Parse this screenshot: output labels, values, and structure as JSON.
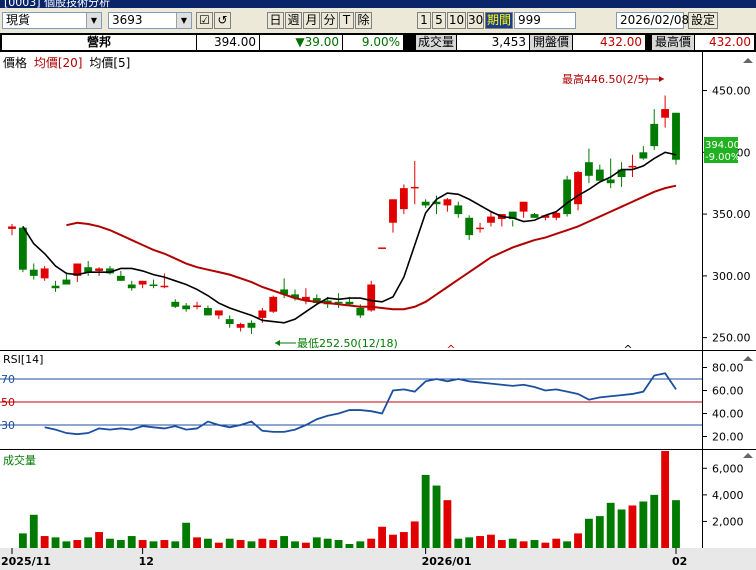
{
  "window": {
    "title": "[0003] 個股技術分析"
  },
  "toolbar": {
    "market": "現貨",
    "code": "3693",
    "period_buttons": [
      "日",
      "週",
      "月",
      "分",
      "T"
    ],
    "remove_label": "除",
    "minute_buttons": [
      "1",
      "5",
      "10",
      "30"
    ],
    "range_label": "期間",
    "range_value": "999",
    "date_value": "2026/02/08",
    "settings_label": "設定"
  },
  "quote": {
    "name": "營邦",
    "price": "394.00",
    "change": "▼39.00",
    "change_pct": "9.00%",
    "volume_label": "成交量",
    "volume": "3,453",
    "open_label": "開盤價",
    "open": "432.00",
    "high_label": "最高價",
    "high": "432.00"
  },
  "price_panel": {
    "legend_price": "價格",
    "legend_ma20": "均價[20]",
    "legend_ma5": "均價[5]",
    "y_ticks": [
      "450.00",
      "400.00",
      "350.00",
      "300.00",
      "250.00"
    ],
    "last_price_tag": "394.00",
    "last_pct_tag": "-9.00%",
    "high_note": "最高446.50(2/5)",
    "low_note": "最低252.50(12/18)"
  },
  "rsi_panel": {
    "label": "RSI[14]",
    "level_labels": [
      "70",
      "50",
      "30"
    ],
    "y_ticks": [
      "80.00",
      "60.00",
      "40.00",
      "20.00"
    ]
  },
  "volume_panel": {
    "label": "成交量",
    "y_ticks": [
      "6,000",
      "4,000",
      "2,000"
    ]
  },
  "x_axis": {
    "labels": [
      "2025/11",
      "12",
      "2026/01",
      "02"
    ]
  },
  "colors": {
    "up": "#e00000",
    "down": "#007a00",
    "ma20": "#b00000",
    "ma5": "#000000",
    "rsi": "#1c4fa0",
    "bg": "#ffffff"
  },
  "chart_data": {
    "type": "candlestick",
    "title": "營邦",
    "ylim": [
      240,
      465
    ],
    "rsi_ylim": [
      10,
      90
    ],
    "volume_ylim": [
      0,
      7000
    ],
    "dates": [
      "2025/11 d1",
      "d2",
      "d3",
      "d4",
      "d5",
      "d6",
      "d7",
      "d8",
      "d9",
      "d10",
      "d11",
      "d12",
      "12 d1",
      "d2",
      "d3",
      "d4",
      "d5",
      "d6",
      "d7",
      "d8",
      "d9",
      "d10",
      "d11",
      "d12",
      "d13",
      "d14",
      "d15",
      "d16",
      "d17",
      "d18",
      "d19",
      "d20",
      "d21",
      "d22",
      "d23",
      "d24",
      "d25",
      "d26",
      "2026/01 d1",
      "d2",
      "d3",
      "d4",
      "d5",
      "d6",
      "d7",
      "d8",
      "d9",
      "d10",
      "d11",
      "d12",
      "d13",
      "d14",
      "d15",
      "d16",
      "d17",
      "d18",
      "d19",
      "d20",
      "d21",
      "d22",
      "d23",
      "02 d1",
      "d2",
      "d3",
      "d4",
      "d5",
      "d6"
    ],
    "ohlc": [
      [
        338,
        342,
        333,
        340
      ],
      [
        339,
        340,
        303,
        305
      ],
      [
        305,
        310,
        297,
        300
      ],
      [
        298,
        308,
        296,
        306
      ],
      [
        292,
        296,
        287,
        290
      ],
      [
        297,
        303,
        293,
        293
      ],
      [
        300,
        310,
        295,
        310
      ],
      [
        307,
        312,
        300,
        303
      ],
      [
        304,
        307,
        300,
        306
      ],
      [
        306,
        308,
        301,
        302
      ],
      [
        300,
        304,
        296,
        296
      ],
      [
        293,
        296,
        288,
        290
      ],
      [
        293,
        296,
        290,
        296
      ],
      [
        293,
        297,
        290,
        292
      ],
      [
        292,
        302,
        290,
        292
      ],
      [
        279,
        281,
        274,
        275
      ],
      [
        276,
        278,
        271,
        273
      ],
      [
        276,
        279,
        273,
        276
      ],
      [
        274,
        276,
        268,
        268
      ],
      [
        268,
        272,
        265,
        272
      ],
      [
        265,
        268,
        258,
        261
      ],
      [
        258,
        262,
        255,
        261
      ],
      [
        262,
        264,
        253,
        258
      ],
      [
        266,
        274,
        262,
        272
      ],
      [
        271,
        284,
        270,
        283
      ],
      [
        289,
        298,
        282,
        285
      ],
      [
        285,
        289,
        280,
        282
      ],
      [
        280,
        290,
        277,
        283
      ],
      [
        282,
        285,
        277,
        278
      ],
      [
        280,
        283,
        274,
        277
      ],
      [
        279,
        286,
        274,
        278
      ],
      [
        279,
        283,
        276,
        277
      ],
      [
        274,
        277,
        266,
        268
      ],
      [
        272,
        296,
        271,
        293
      ],
      [
        323,
        323,
        323,
        323
      ],
      [
        343,
        353,
        335,
        362
      ],
      [
        354,
        374,
        350,
        371
      ],
      [
        372,
        393,
        358,
        372
      ],
      [
        360,
        362,
        355,
        357
      ],
      [
        360,
        365,
        350,
        358
      ],
      [
        357,
        363,
        352,
        362
      ],
      [
        357,
        360,
        347,
        350
      ],
      [
        347,
        349,
        329,
        333
      ],
      [
        338,
        343,
        335,
        339
      ],
      [
        343,
        352,
        340,
        348
      ],
      [
        346,
        350,
        340,
        350
      ],
      [
        352,
        345,
        340,
        346
      ],
      [
        352,
        360,
        347,
        360
      ],
      [
        350,
        351,
        347,
        347
      ],
      [
        347,
        349,
        345,
        349
      ],
      [
        347,
        352,
        345,
        351
      ],
      [
        378,
        381,
        348,
        350
      ],
      [
        358,
        385,
        353,
        384
      ],
      [
        392,
        403,
        375,
        381
      ],
      [
        386,
        390,
        377,
        377
      ],
      [
        378,
        395,
        371,
        375
      ],
      [
        386,
        392,
        372,
        380
      ],
      [
        389,
        398,
        380,
        389
      ],
      [
        400,
        405,
        394,
        395
      ],
      [
        423,
        435,
        402,
        405
      ],
      [
        428,
        446,
        420,
        435
      ],
      [
        432,
        432,
        390,
        394
      ]
    ],
    "ma20": [
      341,
      343,
      342,
      340,
      337,
      333,
      329,
      325,
      321,
      318,
      314,
      310,
      307,
      305,
      303,
      301,
      298,
      295,
      291,
      288,
      285,
      282,
      280,
      279,
      278,
      277,
      276,
      275,
      275,
      274,
      273,
      273,
      275,
      279,
      285,
      291,
      297,
      303,
      309,
      315,
      319,
      323,
      326,
      329,
      331,
      334,
      337,
      340,
      344,
      348,
      352,
      356,
      360,
      364,
      368,
      371,
      373
    ],
    "ma5": [
      340,
      326,
      318,
      308,
      302,
      301,
      303,
      303,
      303,
      306,
      306,
      304,
      301,
      299,
      296,
      293,
      289,
      284,
      278,
      274,
      271,
      268,
      264,
      263,
      262,
      265,
      271,
      277,
      282,
      281,
      282,
      282,
      280,
      279,
      283,
      299,
      325,
      351,
      362,
      367,
      366,
      362,
      357,
      352,
      348,
      347,
      344,
      345,
      349,
      352,
      359,
      365,
      370,
      376,
      380,
      386,
      386,
      389,
      395,
      400,
      398
    ],
    "rsi": [
      28,
      26,
      23,
      22,
      23,
      27,
      26,
      27,
      26,
      29,
      28,
      27,
      29,
      26,
      27,
      33,
      30,
      28,
      30,
      33,
      25,
      24,
      24,
      26,
      30,
      35,
      38,
      40,
      43,
      43,
      42,
      40,
      60,
      61,
      59,
      68,
      70,
      68,
      70,
      68,
      67,
      66,
      65,
      64,
      65,
      63,
      60,
      61,
      59,
      57,
      52,
      54,
      55,
      56,
      57,
      59,
      73,
      75,
      61
    ],
    "volume": [
      1100,
      2500,
      900,
      800,
      500,
      600,
      800,
      1200,
      700,
      600,
      900,
      600,
      500,
      600,
      500,
      1900,
      800,
      700,
      400,
      700,
      600,
      500,
      700,
      600,
      900,
      500,
      400,
      800,
      700,
      600,
      300,
      500,
      700,
      1600,
      1000,
      1200,
      2000,
      5500,
      4700,
      3600,
      700,
      800,
      900,
      1000,
      600,
      700,
      500,
      600,
      400,
      700,
      500,
      1100,
      2200,
      2400,
      3400,
      2900,
      3200,
      3500,
      4000,
      7300,
      3600
    ]
  }
}
